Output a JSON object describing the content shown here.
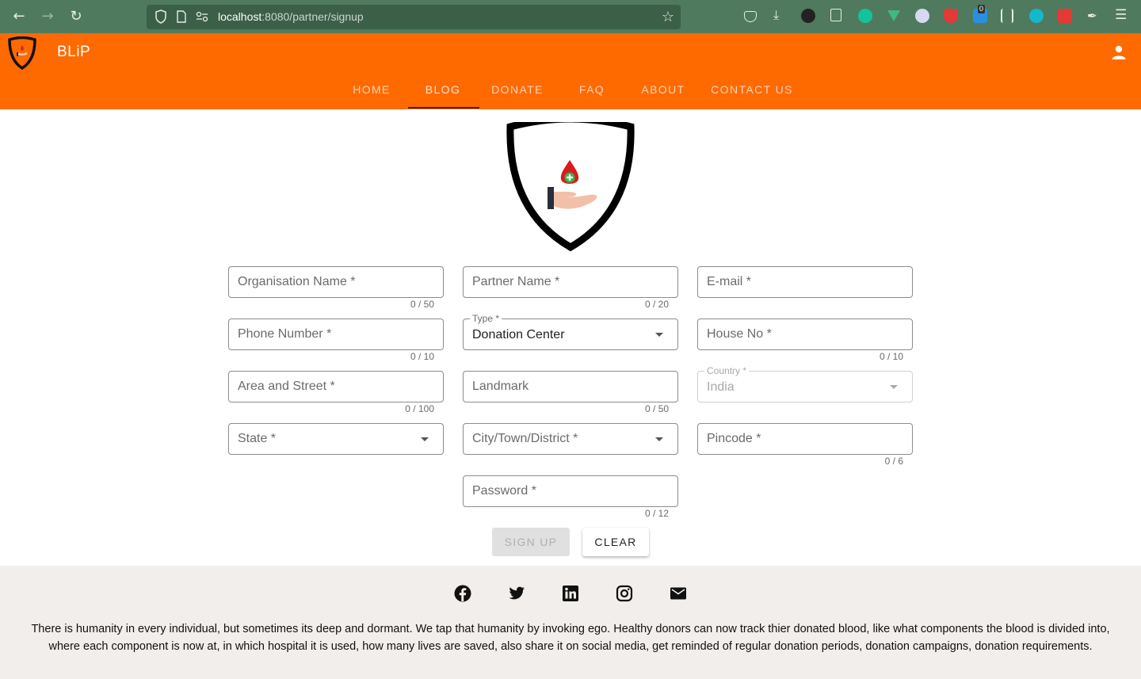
{
  "browser": {
    "url_host": "localhost",
    "url_rest": ":8080/partner/signup",
    "ext_badge": "0"
  },
  "header": {
    "brand": "BLiP",
    "tabs": [
      {
        "label": "HOME"
      },
      {
        "label": "BLOG"
      },
      {
        "label": "DONATE"
      },
      {
        "label": "FAQ"
      },
      {
        "label": "ABOUT"
      },
      {
        "label": "CONTACT US"
      }
    ],
    "active_tab": "BLOG"
  },
  "form": {
    "organisation_name": {
      "placeholder": "Organisation Name *",
      "counter": "0 / 50"
    },
    "partner_name": {
      "placeholder": "Partner Name *",
      "counter": "0 / 20"
    },
    "email": {
      "placeholder": "E-mail *"
    },
    "phone": {
      "placeholder": "Phone Number *",
      "counter": "0 / 10"
    },
    "type": {
      "label": "Type *",
      "value": "Donation Center"
    },
    "house_no": {
      "placeholder": "House No *",
      "counter": "0 / 10"
    },
    "area_street": {
      "placeholder": "Area and Street *",
      "counter": "0 / 100"
    },
    "landmark": {
      "placeholder": "Landmark",
      "counter": "0 / 50"
    },
    "country": {
      "label": "Country *",
      "value": "India"
    },
    "state": {
      "placeholder": "State *"
    },
    "city": {
      "placeholder": "City/Town/District *"
    },
    "pincode": {
      "placeholder": "Pincode *",
      "counter": "0 / 6"
    },
    "password": {
      "placeholder": "Password *",
      "counter": "0 / 12"
    },
    "signup_label": "SIGN UP",
    "clear_label": "CLEAR"
  },
  "footer": {
    "social": [
      "facebook-icon",
      "twitter-icon",
      "linkedin-icon",
      "instagram-icon",
      "mail-icon"
    ],
    "text": "There is humanity in every individual, but sometimes its deep and dormant. We tap that humanity by invoking ego. Healthy donors can now track thier donated blood, like what components the blood is divided into, where each component is now at, in which hospital it is used, how many lives are saved, also share it on social media, get reminded of regular donation periods, donation campaigns, donation requirements."
  },
  "colors": {
    "browser_bar": "#4f7a5e",
    "header": "#ff6a00",
    "footer": "#f1eeec"
  }
}
